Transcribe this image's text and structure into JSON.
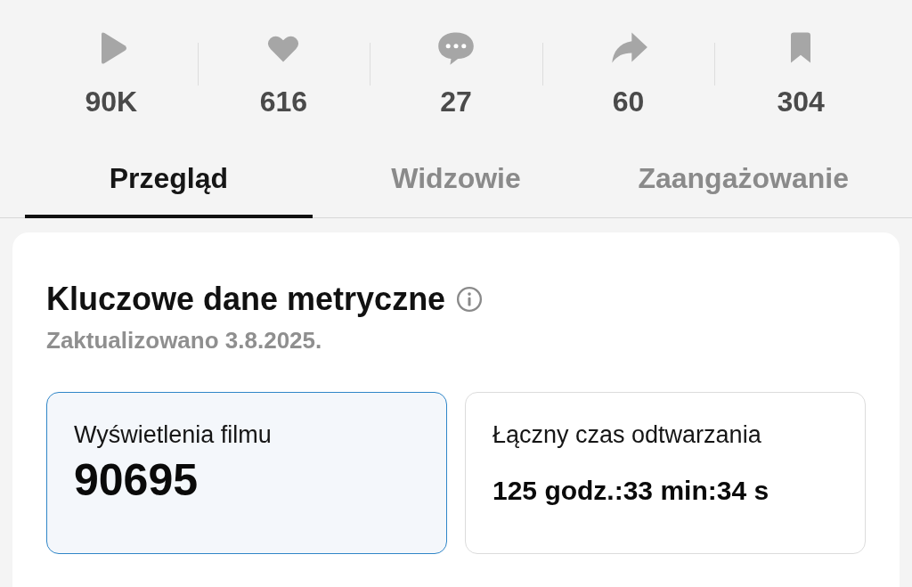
{
  "stats": [
    {
      "kind": "play",
      "value": "90K"
    },
    {
      "kind": "heart",
      "value": "616"
    },
    {
      "kind": "comment",
      "value": "27"
    },
    {
      "kind": "share",
      "value": "60"
    },
    {
      "kind": "bookmark",
      "value": "304"
    }
  ],
  "tabs": [
    {
      "label": "Przegląd",
      "selected": true
    },
    {
      "label": "Widzowie",
      "selected": false
    },
    {
      "label": "Zaangażowanie",
      "selected": false
    }
  ],
  "section": {
    "title": "Kluczowe dane metryczne",
    "updated": "Zaktualizowano 3.8.2025."
  },
  "metrics": [
    {
      "label": "Wyświetlenia filmu",
      "value": "90695",
      "kind": "number",
      "selected": true
    },
    {
      "label": "Łączny czas odtwarzania",
      "value": "125 godz.:33 min:34 s",
      "kind": "duration",
      "selected": false
    }
  ]
}
